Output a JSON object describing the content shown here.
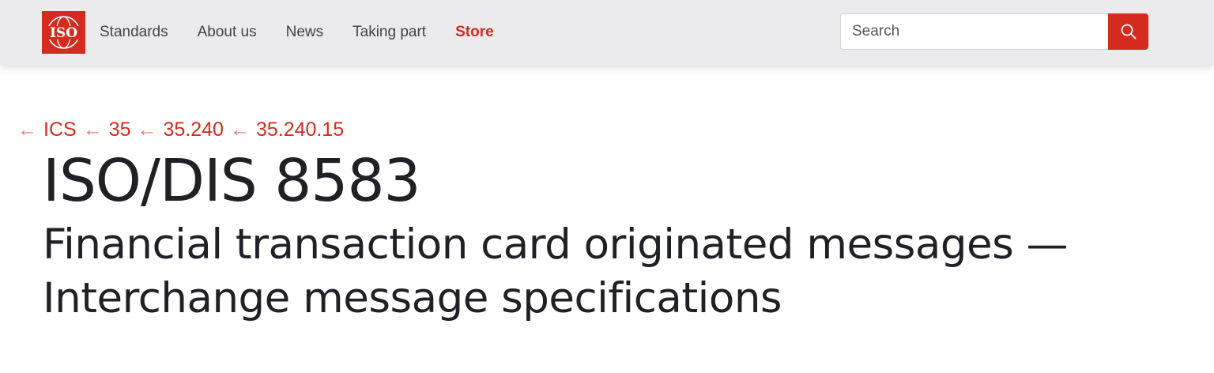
{
  "header": {
    "logo_text": "ISO",
    "nav": [
      {
        "label": "Standards"
      },
      {
        "label": "About us"
      },
      {
        "label": "News"
      },
      {
        "label": "Taking part"
      },
      {
        "label": "Store"
      }
    ],
    "search": {
      "placeholder": "Search",
      "value": ""
    }
  },
  "breadcrumb": [
    {
      "arrow": "←",
      "label": "ICS"
    },
    {
      "arrow": "←",
      "label": "35"
    },
    {
      "arrow": "←",
      "label": "35.240"
    },
    {
      "arrow": "←",
      "label": "35.240.15"
    }
  ],
  "page": {
    "title": "ISO/DIS 8583",
    "subtitle": "Financial transaction card originated messages — Interchange message specifications"
  },
  "colors": {
    "brand_red": "#d52b1e",
    "header_bg": "#ebebee",
    "text_dark": "#202027"
  },
  "icons": {
    "logo": "iso-globe-logo-icon",
    "search": "search-icon",
    "breadcrumb_arrow": "arrow-left-icon"
  }
}
